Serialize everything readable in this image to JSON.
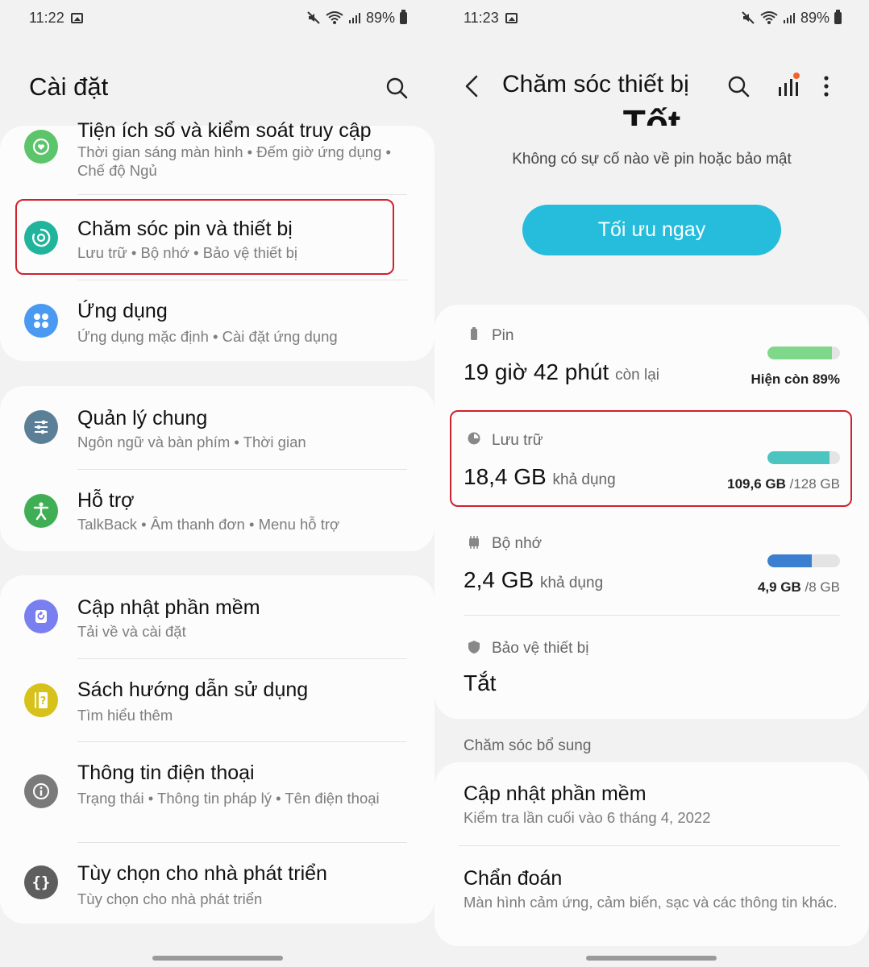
{
  "left": {
    "status": {
      "time": "11:22",
      "battery": "89%"
    },
    "title": "Cài đặt",
    "card1": {
      "items": [
        {
          "title": "Tiện ích số và kiểm soát truy cập",
          "sub": "Thời gian sáng màn hình  •  Đếm giờ ứng dụng  •  Chế độ Ngủ",
          "icon": "wellbeing-icon",
          "color": "#5cc46a"
        },
        {
          "title": "Chăm sóc pin và thiết bị",
          "sub": "Lưu trữ  •  Bộ nhớ  •  Bảo vệ thiết bị",
          "icon": "device-care-icon",
          "color": "#1fb49b"
        },
        {
          "title": "Ứng dụng",
          "sub": "Ứng dụng mặc định  •  Cài đặt ứng dụng",
          "icon": "apps-icon",
          "color": "#4a9af2"
        }
      ]
    },
    "card2": {
      "items": [
        {
          "title": "Quản lý chung",
          "sub": "Ngôn ngữ và bàn phím  •  Thời gian",
          "icon": "general-management-icon",
          "color": "#5c7f98"
        },
        {
          "title": "Hỗ trợ",
          "sub": "TalkBack  •  Âm thanh đơn  •  Menu hỗ trợ",
          "icon": "accessibility-icon",
          "color": "#3fae55"
        }
      ]
    },
    "card3": {
      "items": [
        {
          "title": "Cập nhật phần mềm",
          "sub": "Tải về và cài đặt",
          "icon": "software-update-icon",
          "color": "#7a7ff0"
        },
        {
          "title": "Sách hướng dẫn sử dụng",
          "sub": "Tìm hiểu thêm",
          "icon": "user-manual-icon",
          "color": "#d6c21b"
        },
        {
          "title": "Thông tin điện thoại",
          "sub": "Trạng thái  •  Thông tin pháp lý  •  Tên điện thoại",
          "icon": "about-phone-icon",
          "color": "#7a7a7a"
        },
        {
          "title": "Tùy chọn cho nhà phát triển",
          "sub": "Tùy chọn cho nhà phát triển",
          "icon": "developer-options-icon",
          "color": "#5e5e5e"
        }
      ]
    }
  },
  "right": {
    "status": {
      "time": "11:23",
      "battery": "89%"
    },
    "title": "Chăm sóc thiết bị",
    "score_partial": "Tốt",
    "message": "Không có sự cố nào về pin hoặc bảo mật",
    "optimize_button": "Tối ưu ngay",
    "battery": {
      "label": "Pin",
      "value": "19 giờ 42 phút",
      "suffix": "còn lại",
      "status": "Hiện còn 89%",
      "level": 0.89,
      "color": "#7fd88a"
    },
    "storage": {
      "label": "Lưu trữ",
      "value": "18,4 GB",
      "suffix": "khả dụng",
      "used": "109,6 GB",
      "total": "/128 GB",
      "level": 0.856,
      "color": "#4cc4c0"
    },
    "memory": {
      "label": "Bộ nhớ",
      "value": "2,4 GB",
      "suffix": "khả dụng",
      "used": "4,9 GB",
      "total": "/8 GB",
      "level": 0.61,
      "color": "#3c7fd0"
    },
    "protection": {
      "label": "Bảo vệ thiết bị",
      "value": "Tắt"
    },
    "section_label": "Chăm sóc bổ sung",
    "extra": [
      {
        "title": "Cập nhật phần mềm",
        "sub": "Kiểm tra lần cuối vào 6 tháng 4, 2022"
      },
      {
        "title": "Chẩn đoán",
        "sub": "Màn hình cảm ứng, cảm biến, sạc và các thông tin khác."
      }
    ]
  }
}
